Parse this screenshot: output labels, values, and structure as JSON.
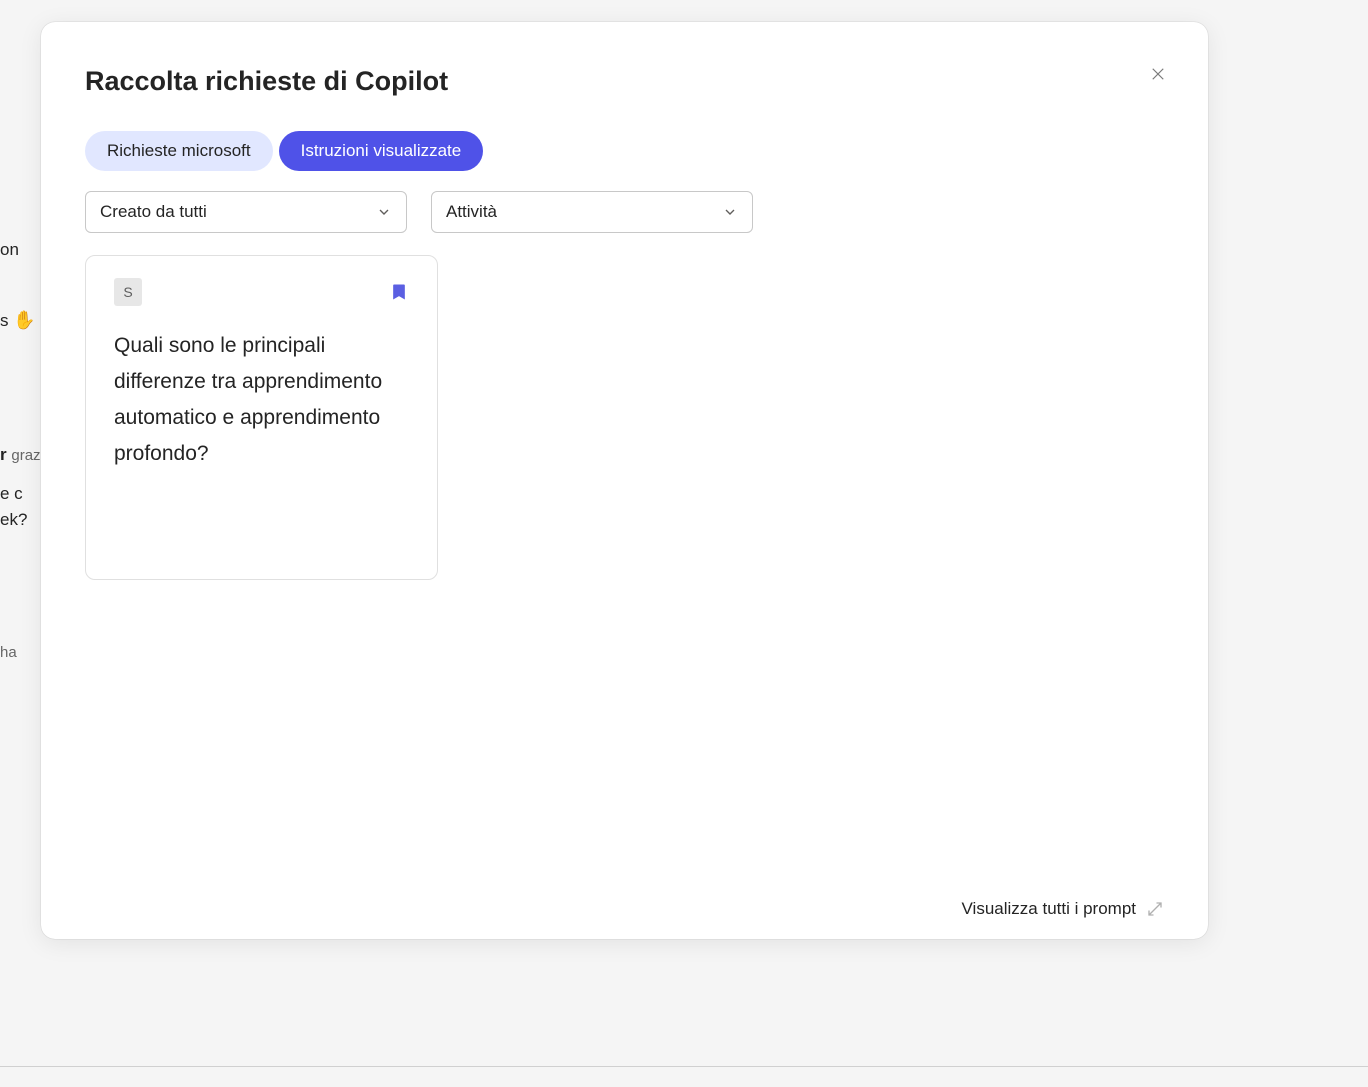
{
  "background": {
    "frag1": "on",
    "frag2": "s",
    "wave": "✋",
    "frag3": "r",
    "frag3b": "grazie",
    "frag4": "e c",
    "frag5": "ek?",
    "frag6": "ha"
  },
  "modal": {
    "title": "Raccolta richieste di Copilot",
    "tabs": {
      "microsoft": "Richieste microsoft",
      "displayed": "Istruzioni visualizzate"
    },
    "filters": {
      "createdBy": "Creato da tutti",
      "activity": "Attività"
    },
    "footer": {
      "viewAll": "Visualizza tutti i prompt"
    }
  },
  "card": {
    "avatarLetter": "S",
    "prompt": "Quali sono le principali differenze tra apprendimento automatico e apprendimento profondo?"
  }
}
